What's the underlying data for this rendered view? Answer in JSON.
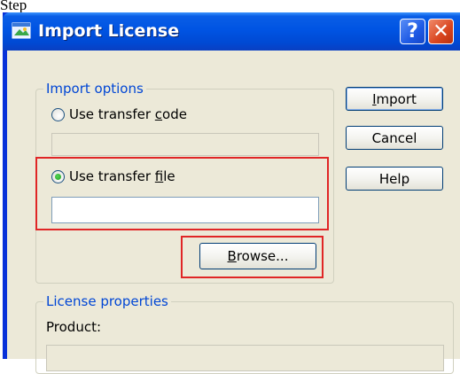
{
  "step_caption": "Step",
  "window": {
    "title": "Import License",
    "help_glyph": "?",
    "close_glyph": "✕"
  },
  "import_options": {
    "legend": "Import options",
    "radio_code": {
      "prefix": "Use transfer ",
      "hotkey": "c",
      "suffix": "ode",
      "checked": false
    },
    "code_value": "",
    "radio_file": {
      "prefix": "Use transfer ",
      "hotkey": "f",
      "suffix": "ile",
      "checked": true
    },
    "file_value": "",
    "browse": {
      "hotkey": "B",
      "rest": "rowse..."
    }
  },
  "buttons": {
    "import": {
      "hotkey": "I",
      "rest": "mport"
    },
    "cancel": "Cancel",
    "help": "Help"
  },
  "license_properties": {
    "legend": "License properties",
    "product_label": "Product:",
    "product_value": ""
  },
  "colors": {
    "titlebar": "#0054e3",
    "group_legend": "#0046d5",
    "highlight": "#e02626",
    "dialog_bg": "#ece9d8"
  }
}
